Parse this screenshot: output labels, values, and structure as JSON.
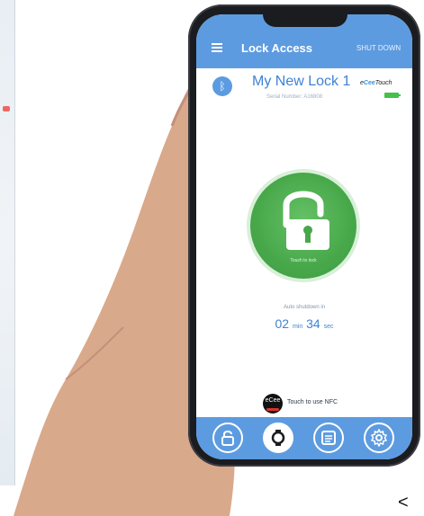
{
  "app": {
    "title": "Lock Access",
    "shutdown_label": "SHUT DOWN",
    "lock_name": "My New Lock 1",
    "serial": "Serial Number: A16808",
    "brand_prefix": "e",
    "brand_accent": "Cee",
    "brand_suffix": "Touch",
    "lock_caption": "Touch to lock",
    "auto_label": "Auto shutdown in",
    "minutes": "02",
    "min_unit": "min",
    "seconds": "34",
    "sec_unit": "sec",
    "nfc_label": "Touch to use NFC",
    "nfc_badge": "eCee"
  },
  "colors": {
    "brand_blue": "#5d9be0",
    "lock_green": "#47a84a"
  },
  "navigation": [
    {
      "id": "nav-lock",
      "icon": "lock-open-icon",
      "active": false
    },
    {
      "id": "nav-watch",
      "icon": "watch-icon",
      "active": true
    },
    {
      "id": "nav-log",
      "icon": "list-icon",
      "active": false
    },
    {
      "id": "nav-settings",
      "icon": "gear-icon",
      "active": false
    }
  ],
  "bluetooth_icon": "bluetooth-icon",
  "battery_level": 1.0
}
